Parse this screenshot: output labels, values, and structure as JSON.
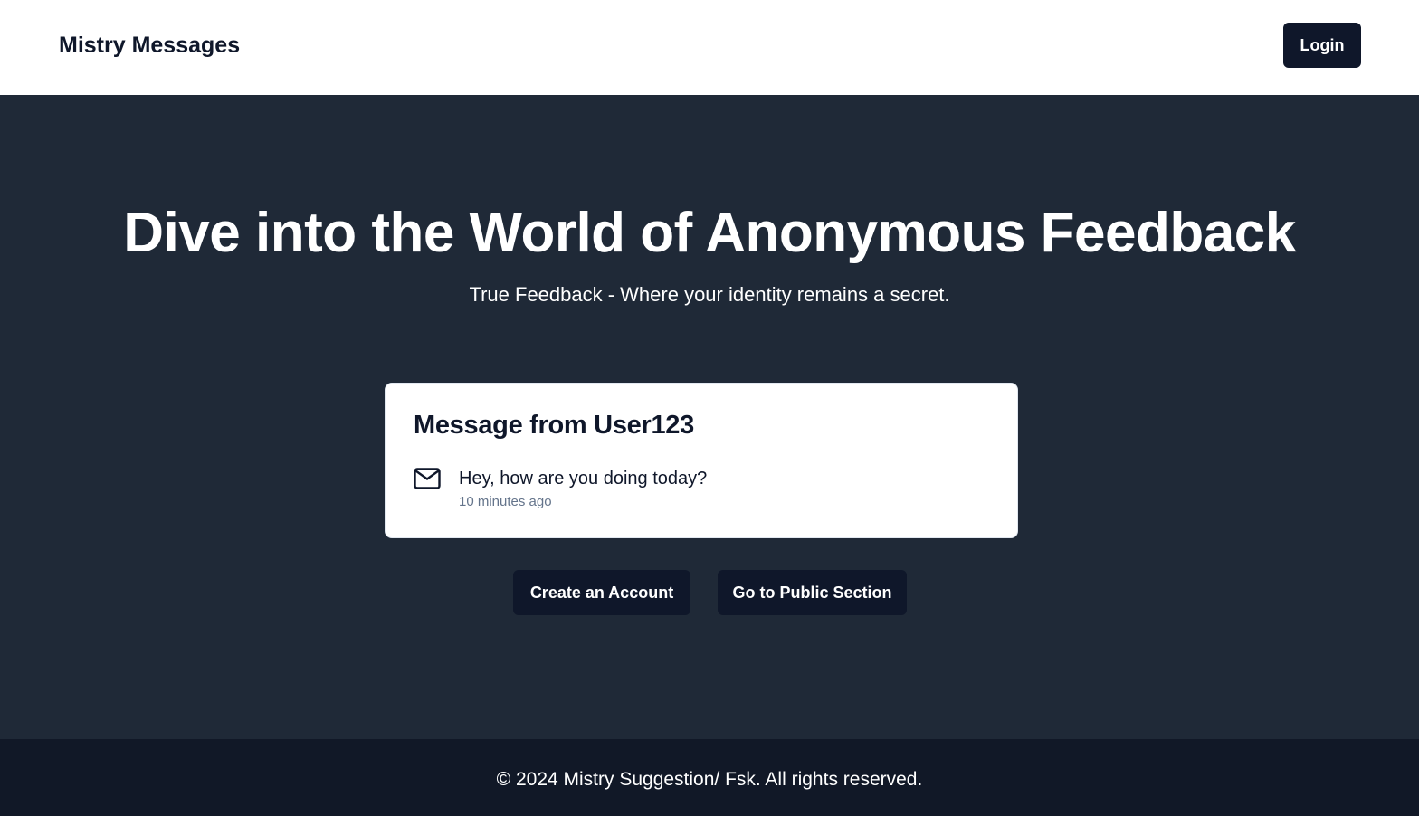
{
  "header": {
    "brand": "Mistry Messages",
    "login_label": "Login"
  },
  "hero": {
    "title": "Dive into the World of Anonymous Feedback",
    "subtitle": "True Feedback - Where your identity remains a secret."
  },
  "message_card": {
    "title": "Message from User123",
    "icon": "mail-icon",
    "text": "Hey, how are you doing today?",
    "time": "10 minutes ago"
  },
  "actions": {
    "create_account": "Create an Account",
    "public_section": "Go to Public Section"
  },
  "footer": {
    "text": "© 2024 Mistry Suggestion/ Fsk. All rights reserved."
  },
  "colors": {
    "header_bg": "#ffffff",
    "hero_bg": "#1f2937",
    "footer_bg": "#111827",
    "button_bg": "#0f172a",
    "muted_text": "#64748b"
  }
}
